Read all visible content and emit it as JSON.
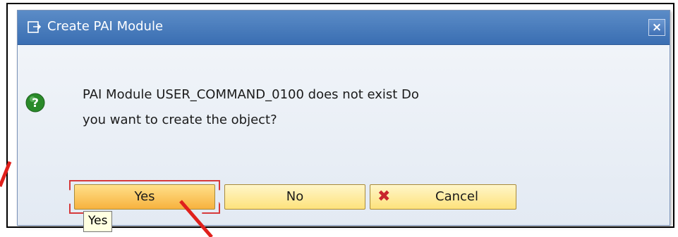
{
  "dialog": {
    "title": "Create PAI Module",
    "close_glyph": "×",
    "message_line1": "PAI Module USER_COMMAND_0100 does not exist Do",
    "message_line2": "you want to create the object?",
    "icon": "question-icon"
  },
  "buttons": {
    "yes_label": "Yes",
    "no_label": "No",
    "cancel_label": "Cancel",
    "cancel_glyph": "✖"
  },
  "tooltip": {
    "text": "Yes"
  },
  "colors": {
    "title_bar": "#3a6eb2",
    "button_fill": "#fde27c",
    "annotation": "#d6393b",
    "question_green": "#2a8a2a"
  }
}
